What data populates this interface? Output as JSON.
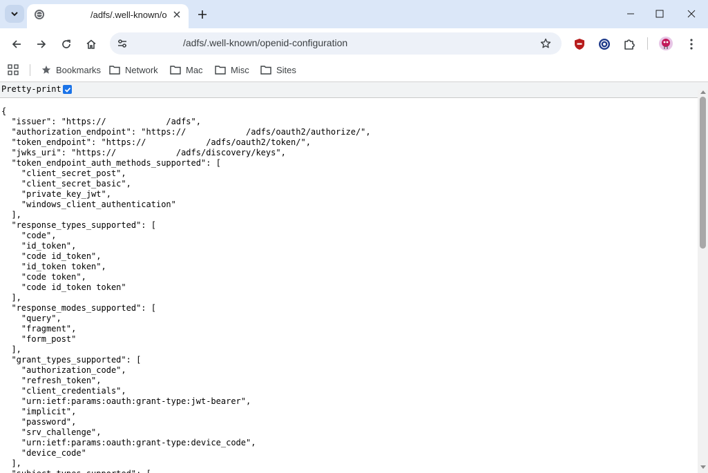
{
  "browser": {
    "tab_title": "/adfs/.well-known/o",
    "url": "/adfs/.well-known/openid-configuration",
    "accent": "#dbe7f8"
  },
  "bookmarks": [
    {
      "label": "Bookmarks",
      "icon": "star-icon"
    },
    {
      "label": "Network",
      "icon": "folder-icon"
    },
    {
      "label": "Mac",
      "icon": "folder-icon"
    },
    {
      "label": "Misc",
      "icon": "folder-icon"
    },
    {
      "label": "Sites",
      "icon": "folder-icon"
    }
  ],
  "page": {
    "pretty_print_label": "Pretty-print",
    "pretty_print_checked": true,
    "json_lines": [
      "{",
      "  \"issuer\": \"https://            /adfs\",",
      "  \"authorization_endpoint\": \"https://            /adfs/oauth2/authorize/\",",
      "  \"token_endpoint\": \"https://            /adfs/oauth2/token/\",",
      "  \"jwks_uri\": \"https://            /adfs/discovery/keys\",",
      "  \"token_endpoint_auth_methods_supported\": [",
      "    \"client_secret_post\",",
      "    \"client_secret_basic\",",
      "    \"private_key_jwt\",",
      "    \"windows_client_authentication\"",
      "  ],",
      "  \"response_types_supported\": [",
      "    \"code\",",
      "    \"id_token\",",
      "    \"code id_token\",",
      "    \"id_token token\",",
      "    \"code token\",",
      "    \"code id_token token\"",
      "  ],",
      "  \"response_modes_supported\": [",
      "    \"query\",",
      "    \"fragment\",",
      "    \"form_post\"",
      "  ],",
      "  \"grant_types_supported\": [",
      "    \"authorization_code\",",
      "    \"refresh_token\",",
      "    \"client_credentials\",",
      "    \"urn:ietf:params:oauth:grant-type:jwt-bearer\",",
      "    \"implicit\",",
      "    \"password\",",
      "    \"srv_challenge\",",
      "    \"urn:ietf:params:oauth:grant-type:device_code\",",
      "    \"device_code\"",
      "  ],",
      "  \"subject_types_supported\": ["
    ]
  }
}
